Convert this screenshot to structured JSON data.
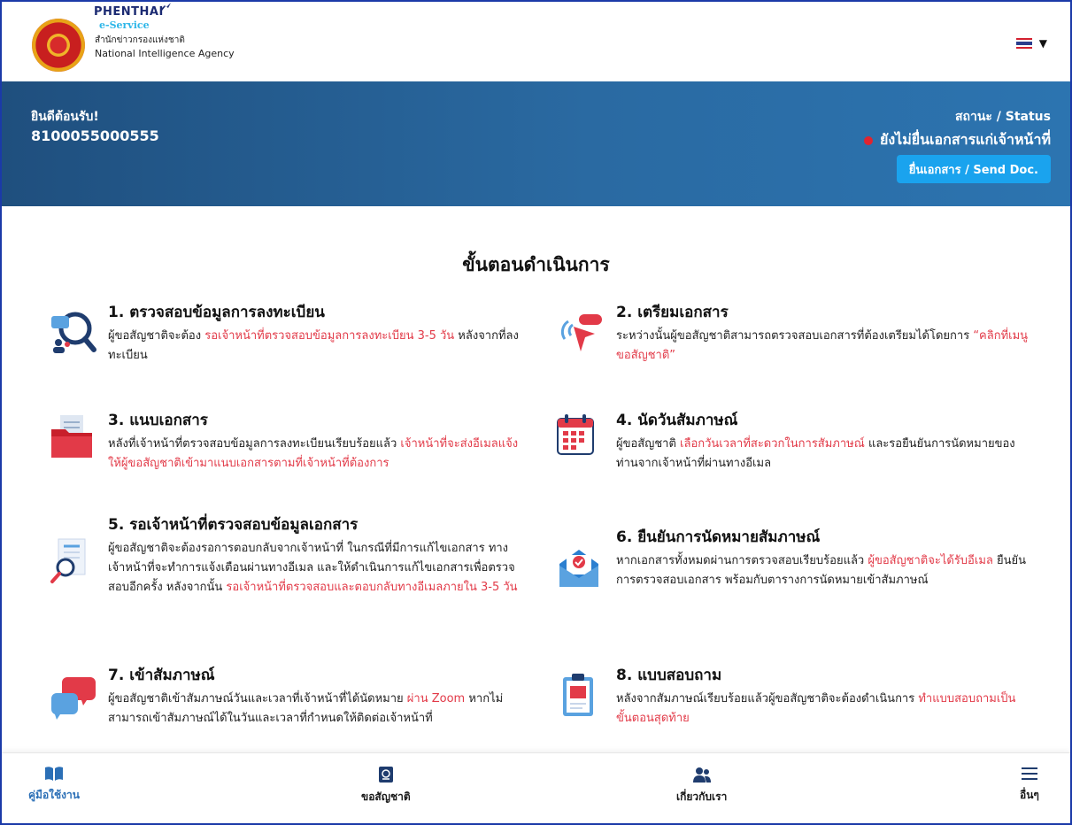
{
  "header": {
    "brand_name": "PHENTHAI",
    "brand_sub": "e-Service",
    "agency_th": "สำนักข่าวกรองแห่งชาติ",
    "agency_en": "National Intelligence Agency",
    "lang_icon": "thai-flag-icon"
  },
  "banner": {
    "welcome": "ยินดีต้อนรับ!",
    "user_id": "8100055000555",
    "status_label": "สถานะ / Status",
    "status_value": "ยังไม่ยื่นเอกสารแก่เจ้าหน้าที่",
    "send_button": "ยื่นเอกสาร / Send Doc."
  },
  "main": {
    "title": "ขั้นตอนดำเนินการ",
    "steps": [
      {
        "title": "1. ตรวจสอบข้อมูลการลงทะเบียน",
        "t1": "ผู้ขอสัญชาติจะต้อง ",
        "h1": "รอเจ้าหน้าที่ตรวจสอบข้อมูลการลงทะเบียน 3-5 วัน",
        "t2": " หลังจากที่ลงทะเบียน"
      },
      {
        "title": "2. เตรียมเอกสาร",
        "t1": "ระหว่างนั้นผู้ขอสัญชาติสามารถตรวจสอบเอกสารที่ต้องเตรียมได้โดยการ ",
        "h1": "“คลิกที่เมนูขอสัญชาติ”",
        "t2": ""
      },
      {
        "title": "3. แนบเอกสาร",
        "t1": "หลังที่เจ้าหน้าที่ตรวจสอบข้อมูลการลงทะเบียนเรียบร้อยแล้ว ",
        "h1": "เจ้าหน้าที่จะส่งอีเมลแจ้งให้ผู้ขอสัญชาติเข้ามาแนบเอกสารตามที่เจ้าหน้าที่ต้องการ",
        "t2": ""
      },
      {
        "title": "4. นัดวันสัมภาษณ์",
        "t1": "ผู้ขอสัญชาติ ",
        "h1": "เลือกวันเวลาที่สะดวกในการสัมภาษณ์",
        "t2": " และรอยืนยันการนัดหมายของท่านจากเจ้าหน้าที่ผ่านทางอีเมล"
      },
      {
        "title": "5. รอเจ้าหน้าที่ตรวจสอบข้อมูลเอกสาร",
        "t1": "ผู้ขอสัญชาติจะต้องรอการตอบกลับจากเจ้าหน้าที่ ในกรณีที่มีการแก้ไขเอกสาร ทางเจ้าหน้าที่จะทำการแจ้งเตือนผ่านทางอีเมล และให้ดำเนินการแก้ไขเอกสารเพื่อตรวจสอบอีกครั้ง หลังจากนั้น ",
        "h1": "รอเจ้าหน้าที่ตรวจสอบและตอบกลับทางอีเมลภายใน 3-5 วัน",
        "t2": ""
      },
      {
        "title": "6. ยืนยันการนัดหมายสัมภาษณ์",
        "t1": "หากเอกสารทั้งหมดผ่านการตรวจสอบเรียบร้อยแล้ว ",
        "h1": "ผู้ขอสัญชาติจะได้รับอีเมล",
        "t2": " ยืนยันการตรวจสอบเอกสาร พร้อมกับตารางการนัดหมายเข้าสัมภาษณ์"
      },
      {
        "title": "7. เข้าสัมภาษณ์",
        "t1": "ผู้ขอสัญชาติเข้าสัมภาษณ์วันและเวลาที่เจ้าหน้าที่ได้นัดหมาย ",
        "h1": "ผ่าน Zoom",
        "t2": " หากไม่สามารถเข้าสัมภาษณ์ได้ในวันและเวลาที่กำหนดให้ติดต่อเจ้าหน้าที่"
      },
      {
        "title": "8. แบบสอบถาม",
        "t1": "หลังจากสัมภาษณ์เรียบร้อยแล้วผู้ขอสัญชาติจะต้องดำเนินการ ",
        "h1": "ทำแบบสอบถามเป็นขั้นตอนสุดท้าย",
        "t2": ""
      }
    ]
  },
  "nav": {
    "guide": "คู่มือใช้งาน",
    "nationality": "ขอสัญชาติ",
    "about": "เกี่ยวกับเรา",
    "more": "อื่นๆ"
  },
  "colors": {
    "accent_blue": "#1aa3ee",
    "highlight_red": "#e23a48",
    "banner": "#2a6aa2",
    "status_dot": "#e0242f"
  }
}
